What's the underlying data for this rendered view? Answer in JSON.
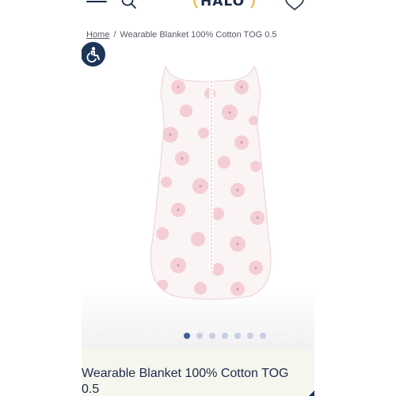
{
  "header": {
    "logo_text": "HALO",
    "menu_icon": "hamburger-menu-icon",
    "search_icon": "search-icon",
    "wishlist_icon": "heart-icon"
  },
  "breadcrumb": {
    "home": "Home",
    "separator": "/",
    "current": "Wearable Blanket 100% Cotton TOG 0.5"
  },
  "accessibility": {
    "icon": "accessibility-icon"
  },
  "carousel": {
    "total_slides": 7,
    "active_index": 0
  },
  "product": {
    "title": "Wearable Blanket 100% Cotton TOG 0.5"
  },
  "colors": {
    "navy": "#1c2b4b",
    "accessibility_button": "#1c3559",
    "active_dot": "#3b5f9c",
    "inactive_dot": "#c7cfe0",
    "info_background": "#f7f6ee",
    "blanket_pink": "#f3c6cf"
  }
}
